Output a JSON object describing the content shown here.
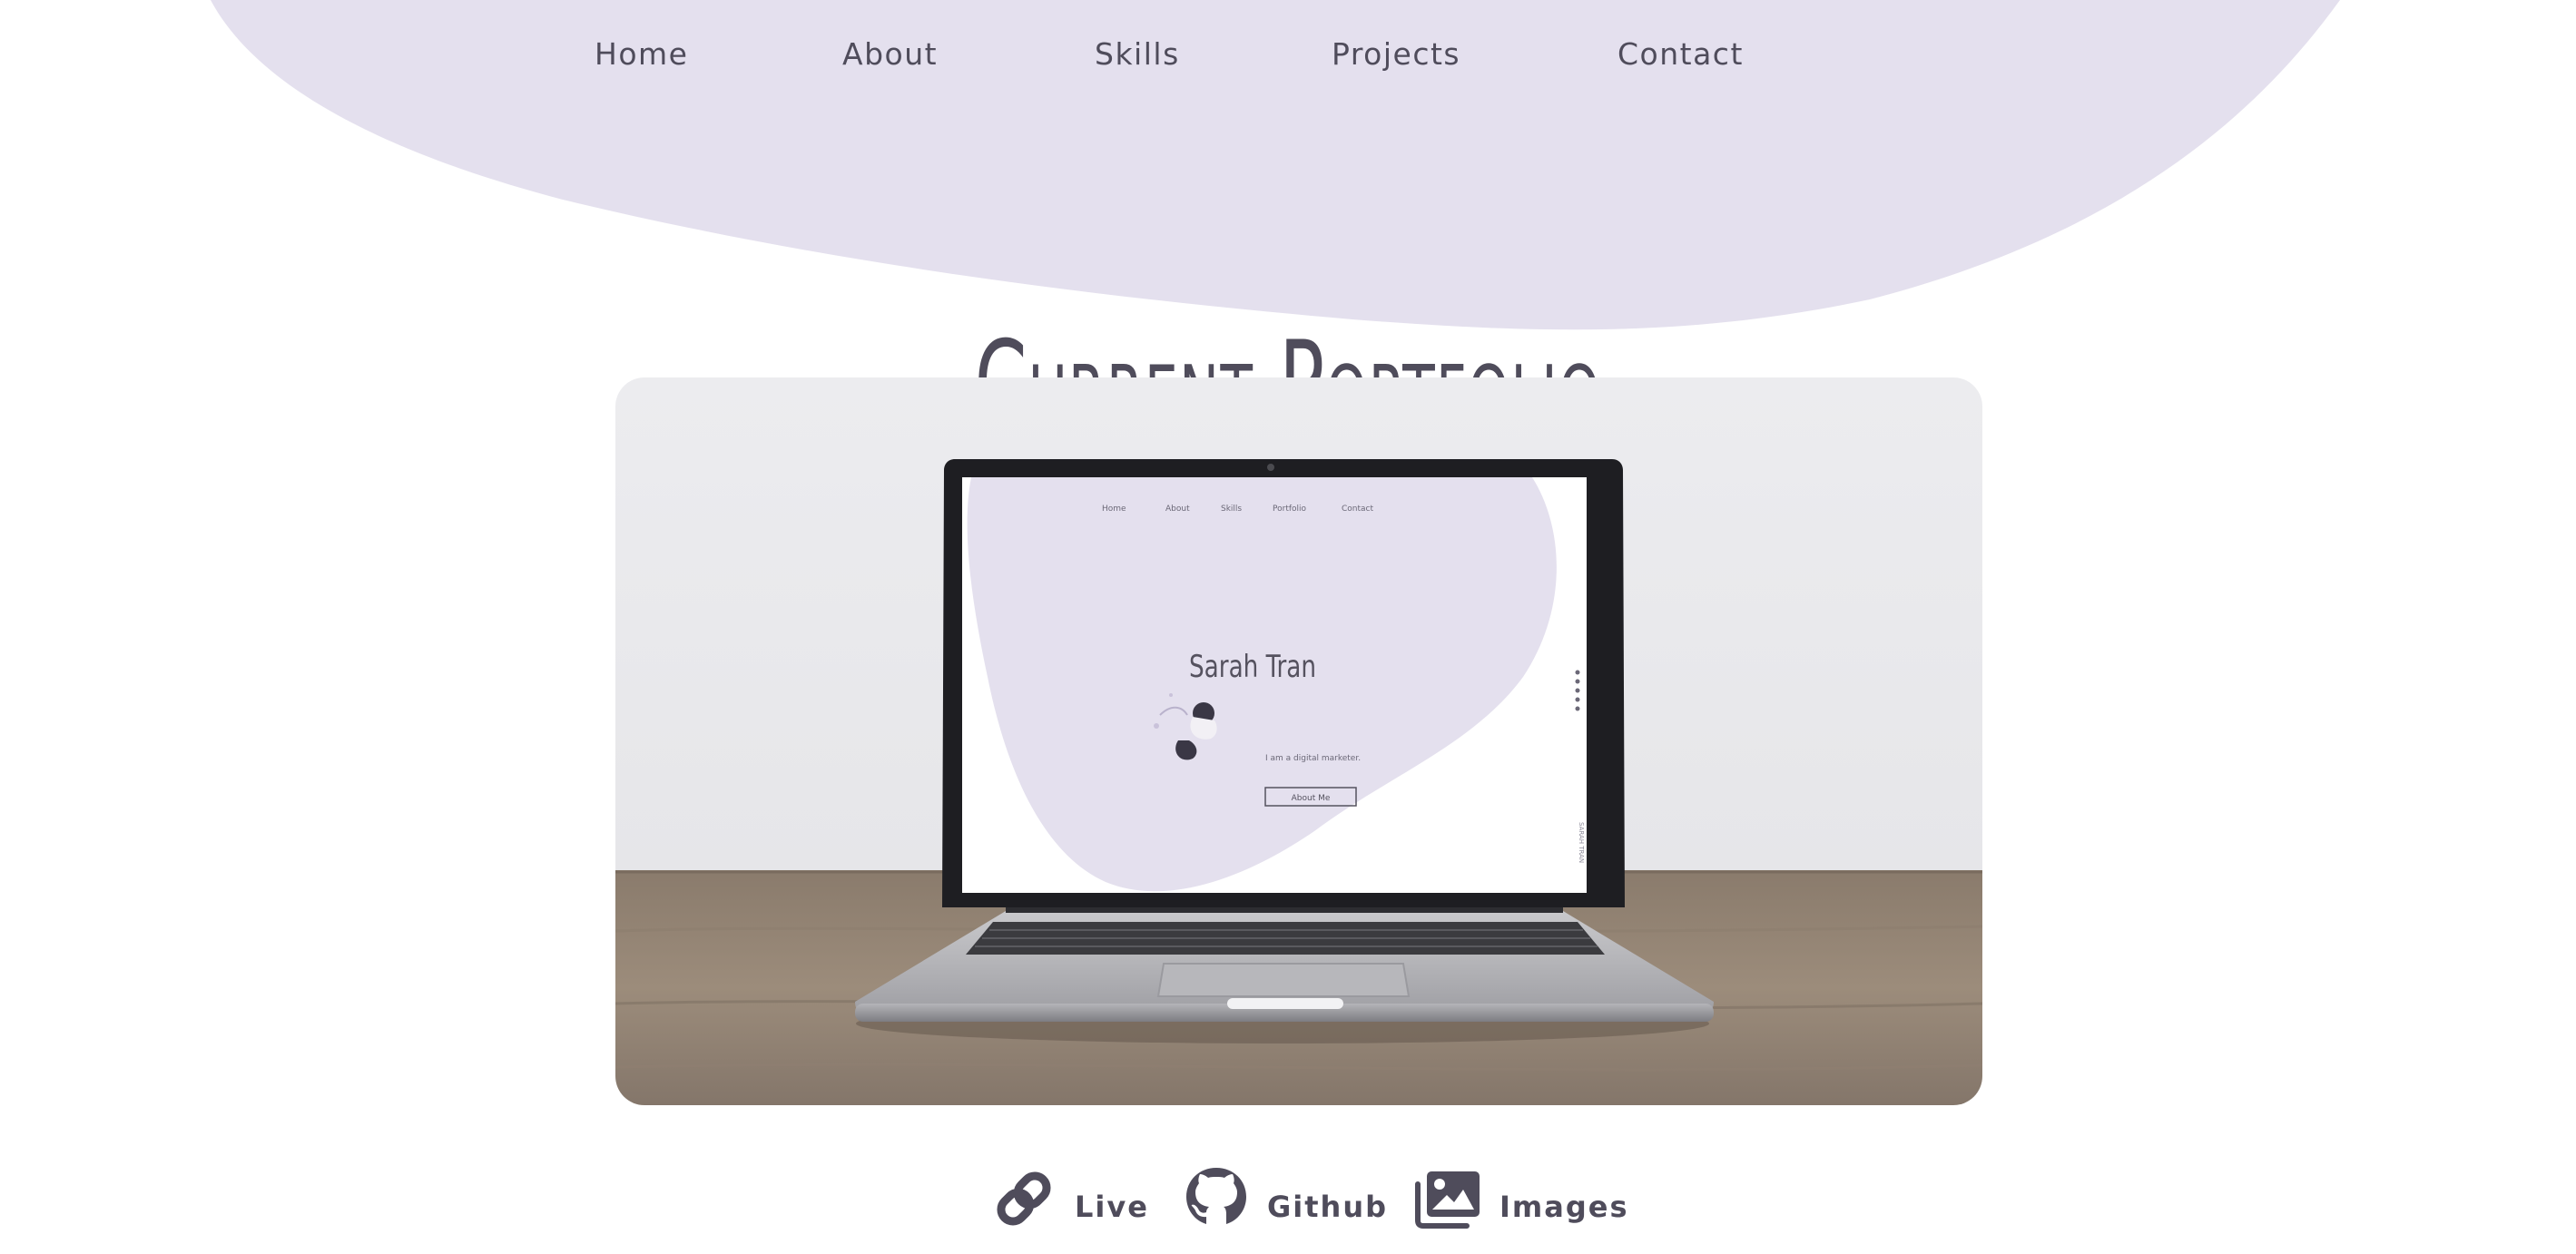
{
  "colors": {
    "accent": "#e4e0ee",
    "text": "#4f4c5b",
    "background": "#ffffff"
  },
  "nav": {
    "items": [
      {
        "label": "Home"
      },
      {
        "label": "About"
      },
      {
        "label": "Skills"
      },
      {
        "label": "Projects"
      },
      {
        "label": "Contact"
      }
    ]
  },
  "section": {
    "title": "Current Portfolio"
  },
  "preview": {
    "nav": [
      "Home",
      "About",
      "Skills",
      "Portfolio",
      "Contact"
    ],
    "name": "Sarah Tran",
    "tagline": "I am a digital marketer.",
    "button": "About Me",
    "side_text": "SARAH TRAN"
  },
  "links": {
    "items": [
      {
        "label": "Live",
        "icon": "link-icon"
      },
      {
        "label": "Github",
        "icon": "github-icon"
      },
      {
        "label": "Images",
        "icon": "images-icon"
      }
    ]
  }
}
